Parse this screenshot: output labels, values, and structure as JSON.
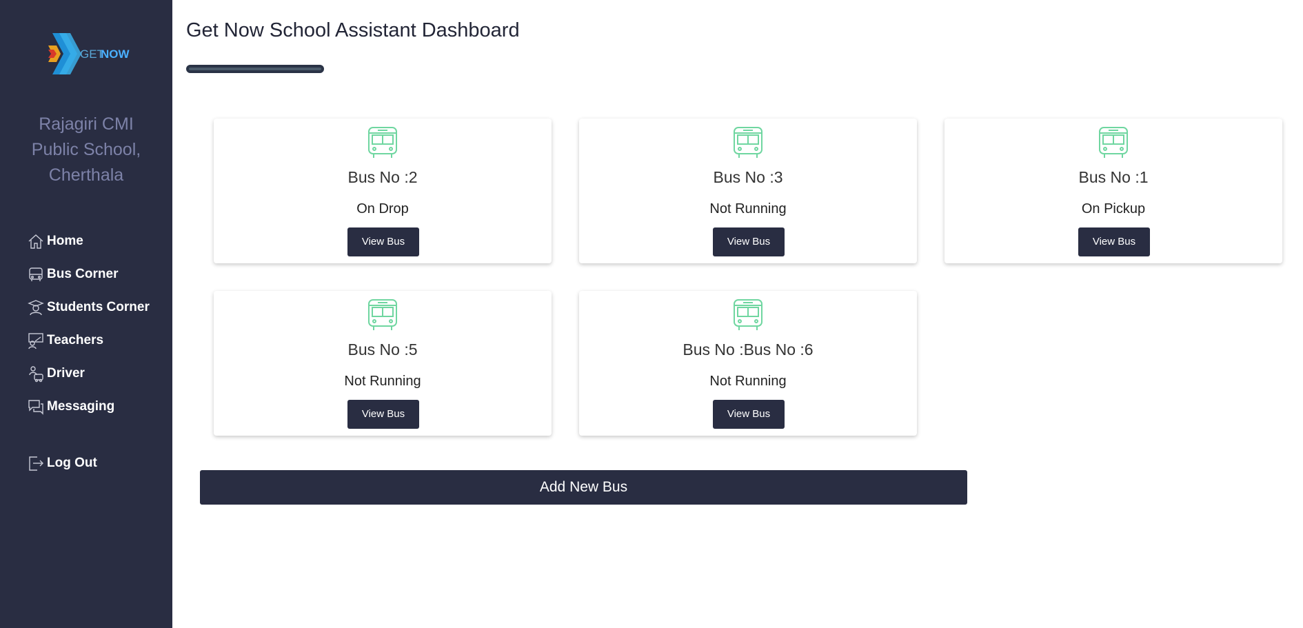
{
  "sidebar": {
    "logo_text_get": "GET",
    "logo_text_now": "NOW",
    "school_name_line1": "Rajagiri CMI",
    "school_name_line2": "Public School,",
    "school_name_line3": "Cherthala",
    "items": [
      {
        "label": "Home",
        "icon": "home-icon"
      },
      {
        "label": "Bus Corner",
        "icon": "bus-icon"
      },
      {
        "label": "Students Corner",
        "icon": "student-icon"
      },
      {
        "label": "Teachers",
        "icon": "teacher-icon"
      },
      {
        "label": "Driver",
        "icon": "driver-icon"
      },
      {
        "label": "Messaging",
        "icon": "message-icon"
      }
    ],
    "logout_label": "Log Out"
  },
  "main": {
    "title": "Get Now School Assistant Dashboard",
    "buses": [
      {
        "bus_no": "Bus No :2",
        "status": "On Drop",
        "button": "View Bus"
      },
      {
        "bus_no": "Bus No :3",
        "status": "Not Running",
        "button": "View Bus"
      },
      {
        "bus_no": "Bus No :1",
        "status": "On Pickup",
        "button": "View Bus"
      },
      {
        "bus_no": "Bus No :5",
        "status": "Not Running",
        "button": "View Bus"
      },
      {
        "bus_no": "Bus No :Bus No :6",
        "status": "Not Running",
        "button": "View Bus"
      }
    ],
    "add_button": "Add New Bus"
  },
  "colors": {
    "sidebar_bg": "#292d42",
    "school_name": "#7d82a8",
    "button_bg": "#292d42",
    "bus_icon": "#6fd6a0"
  }
}
